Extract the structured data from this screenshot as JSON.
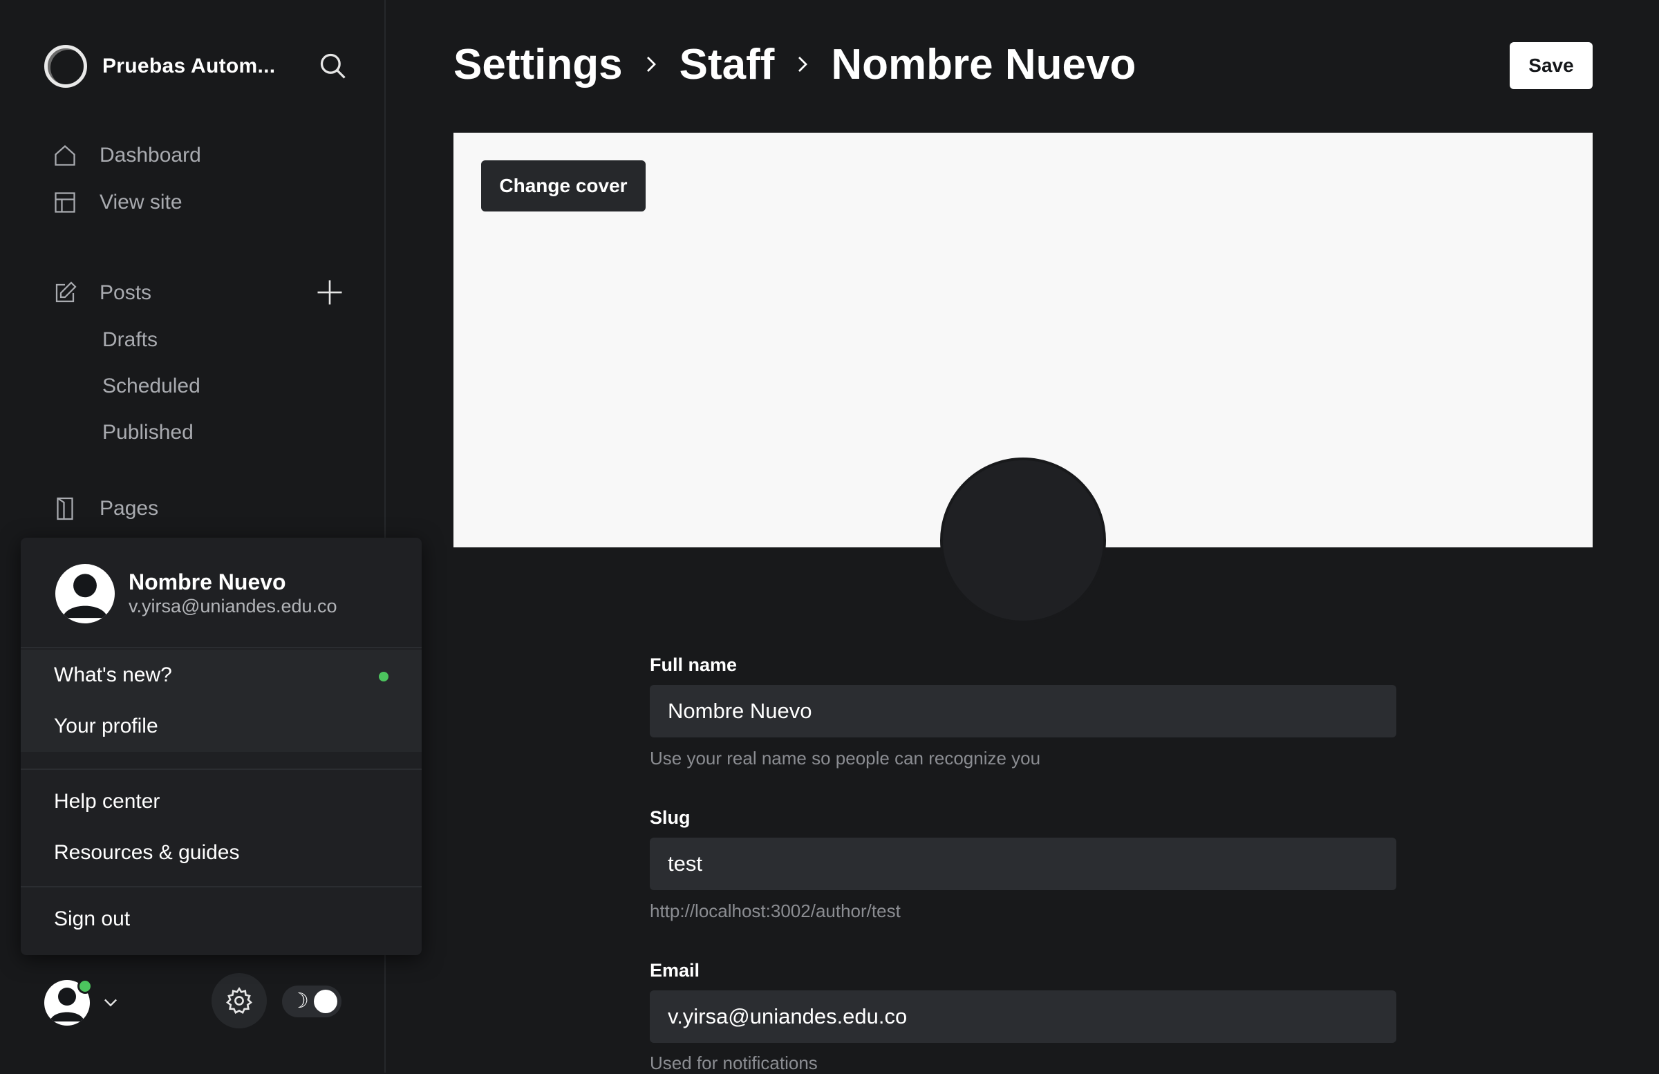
{
  "brand": {
    "name": "Pruebas Autom..."
  },
  "nav": {
    "dashboard": "Dashboard",
    "view_site": "View site",
    "posts": "Posts",
    "drafts": "Drafts",
    "scheduled": "Scheduled",
    "published": "Published",
    "pages": "Pages"
  },
  "user_menu": {
    "name": "Nombre Nuevo",
    "email": "v.yirsa@uniandes.edu.co",
    "whats_new": "What's new?",
    "your_profile": "Your profile",
    "help_center": "Help center",
    "resources": "Resources & guides",
    "sign_out": "Sign out"
  },
  "footer": {
    "theme_toggle_icon": "☽"
  },
  "header": {
    "crumbs": [
      "Settings",
      "Staff",
      "Nombre Nuevo"
    ],
    "save_label": "Save"
  },
  "cover": {
    "change_label": "Change cover"
  },
  "form": {
    "full_name": {
      "label": "Full name",
      "value": "Nombre Nuevo",
      "hint": "Use your real name so people can recognize you"
    },
    "slug": {
      "label": "Slug",
      "value": "test",
      "hint": "http://localhost:3002/author/test"
    },
    "email": {
      "label": "Email",
      "value": "v.yirsa@uniandes.edu.co",
      "hint": "Used for notifications"
    }
  },
  "colors": {
    "background": "#18191b",
    "status_green": "#4cc45e",
    "cover_bg": "#f8f8f8"
  }
}
